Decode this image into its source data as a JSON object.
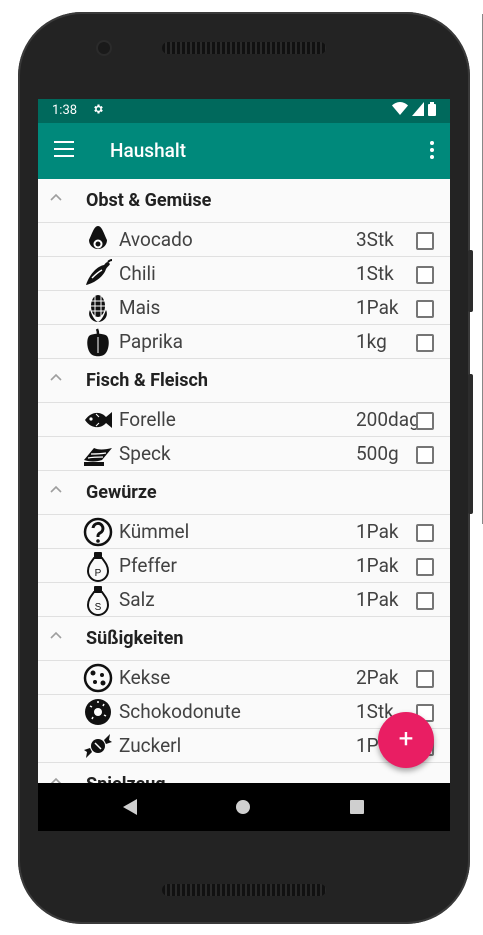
{
  "status": {
    "time": "1:38"
  },
  "appbar": {
    "title": "Haushalt"
  },
  "colors": {
    "statusbar": "#00695c",
    "appbar": "#00897b",
    "fab": "#e91e63"
  },
  "sections": [
    {
      "title": "Obst & Gemüse",
      "items": [
        {
          "name": "Avocado",
          "qty": "3Stk",
          "icon": "avocado-icon"
        },
        {
          "name": "Chili",
          "qty": "1Stk",
          "icon": "chili-icon"
        },
        {
          "name": "Mais",
          "qty": "1Pak",
          "icon": "corn-icon"
        },
        {
          "name": "Paprika",
          "qty": "1kg",
          "icon": "pepper-icon"
        }
      ]
    },
    {
      "title": "Fisch & Fleisch",
      "items": [
        {
          "name": "Forelle",
          "qty": "200dag",
          "icon": "fish-icon"
        },
        {
          "name": "Speck",
          "qty": "500g",
          "icon": "bacon-icon"
        }
      ]
    },
    {
      "title": "Gewürze",
      "items": [
        {
          "name": "Kümmel",
          "qty": "1Pak",
          "icon": "question-icon"
        },
        {
          "name": "Pfeffer",
          "qty": "1Pak",
          "icon": "pepper-shaker-icon"
        },
        {
          "name": "Salz",
          "qty": "1Pak",
          "icon": "salt-shaker-icon"
        }
      ]
    },
    {
      "title": "Süßigkeiten",
      "items": [
        {
          "name": "Kekse",
          "qty": "2Pak",
          "icon": "cookie-icon"
        },
        {
          "name": "Schokodonute",
          "qty": "1Stk",
          "icon": "donut-icon"
        },
        {
          "name": "Zuckerl",
          "qty": "1P",
          "icon": "candy-icon"
        }
      ]
    },
    {
      "title": "Spielzeug",
      "items": []
    }
  ],
  "fab": {
    "label": "+"
  }
}
